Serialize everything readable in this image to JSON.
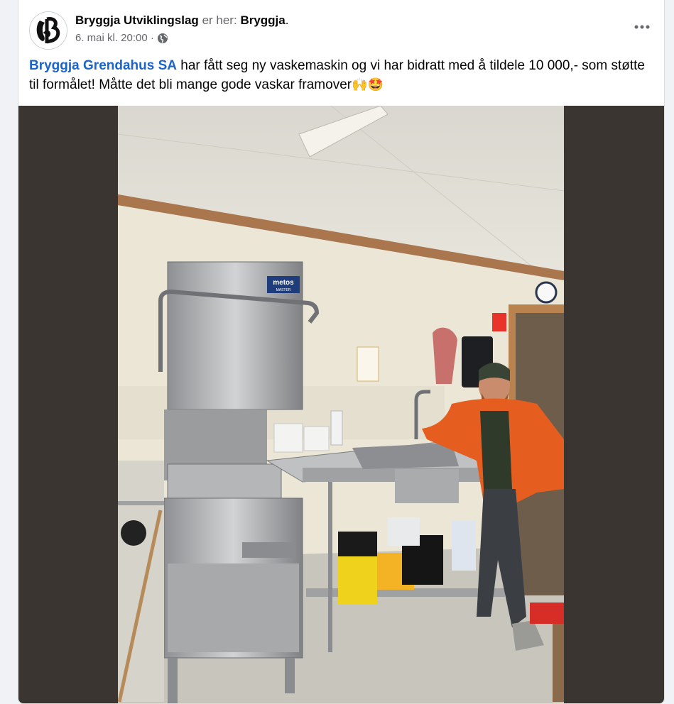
{
  "post": {
    "author": "Bryggja Utviklingslag",
    "is_here_text": "er her:",
    "place": "Bryggja",
    "place_suffix": ".",
    "timestamp": "6. mai kl. 20:00 ·",
    "audience_icon": "globe-icon",
    "more_icon": "more-horizontal-icon",
    "mention": "Bryggja Grendahus SA",
    "body_text": " har fått seg ny vaskemaskin og vi har bidratt med å tildele 10 000,- som støtte til formålet! Måtte det bli mange gode vaskar framover",
    "emojis": "🙌🤩"
  },
  "photo": {
    "machine_brand": "metos",
    "machine_model": "MASTER"
  },
  "colors": {
    "link": "#1b64c9",
    "secondary_text": "#65676b",
    "media_background": "#3a3530"
  }
}
